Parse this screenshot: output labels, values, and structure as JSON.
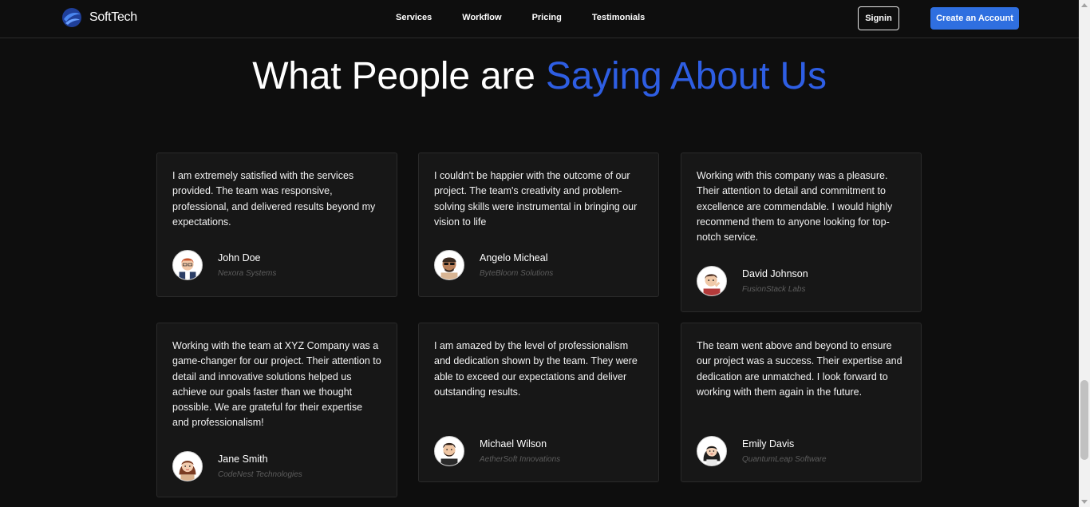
{
  "brand": {
    "name": "SoftTech",
    "logo_icon": "globe-swirl-icon",
    "color": "#2e5ee3"
  },
  "nav": {
    "links": [
      "Services",
      "Workflow",
      "Pricing",
      "Testimonials"
    ],
    "signin_label": "Signin",
    "create_label": "Create an Account"
  },
  "heading": {
    "prefix": "What People are",
    "accent": "Saying About Us",
    "accent_color": "#2e5ee3"
  },
  "testimonials": [
    {
      "quote": "I am extremely satisfied with the services provided. The team was responsive, professional, and delivered results beyond my expectations.",
      "name": "John Doe",
      "company": "Nexora Systems",
      "avatar": "man-red-hair-avatar-icon"
    },
    {
      "quote": "I couldn't be happier with the outcome of our project. The team's creativity and problem-solving skills were instrumental in bringing our vision to life",
      "name": "Angelo Micheal",
      "company": "ByteBloom Solutions",
      "avatar": "man-sunglasses-avatar-icon"
    },
    {
      "quote": "Working with this company was a pleasure. Their attention to detail and commitment to excellence are commendable. I would highly recommend them to anyone looking for top-notch service.",
      "name": "David Johnson",
      "company": "FusionStack Labs",
      "avatar": "man-thinking-avatar-icon"
    },
    {
      "quote": "Working with the team at XYZ Company was a game-changer for our project. Their attention to detail and innovative solutions helped us achieve our goals faster than we thought possible. We are grateful for their expertise and professionalism!",
      "name": "Jane Smith",
      "company": "CodeNest Technologies",
      "avatar": "woman-brown-hair-avatar-icon"
    },
    {
      "quote": "I am amazed by the level of professionalism and dedication shown by the team. They were able to exceed our expectations and deliver outstanding results.",
      "name": "Michael Wilson",
      "company": "AetherSoft Innovations",
      "avatar": "man-beard-avatar-icon"
    },
    {
      "quote": "The team went above and beyond to ensure our project was a success. Their expertise and dedication are unmatched. I look forward to working with them again in the future.",
      "name": "Emily Davis",
      "company": "QuantumLeap Software",
      "avatar": "woman-dark-hair-avatar-icon"
    }
  ]
}
